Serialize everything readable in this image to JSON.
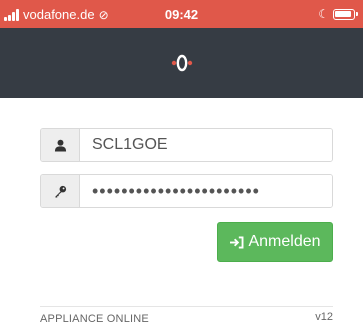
{
  "status_bar": {
    "carrier": "vodafone.de",
    "time": "09:42",
    "signal_icon": "signal-icon",
    "sync_icon": "sync-icon",
    "moon_icon": "moon-icon",
    "battery_icon": "battery-icon",
    "background_color": "#e0584a"
  },
  "header": {
    "background_color": "#363c44",
    "logo_icon": "brand-logo-icon",
    "logo_color": "#ffffff",
    "logo_accent_color": "#e0584a"
  },
  "login_form": {
    "username": {
      "icon": "user-icon",
      "value": "SCL1GOE"
    },
    "password": {
      "icon": "key-icon",
      "masked_value": "•••••••••••••••••••••••"
    },
    "submit": {
      "icon": "sign-in-icon",
      "label": "Anmelden",
      "color": "#5cb85c"
    }
  },
  "footer": {
    "left_text": "APPLIANCE ONLINE",
    "version": "v12"
  }
}
